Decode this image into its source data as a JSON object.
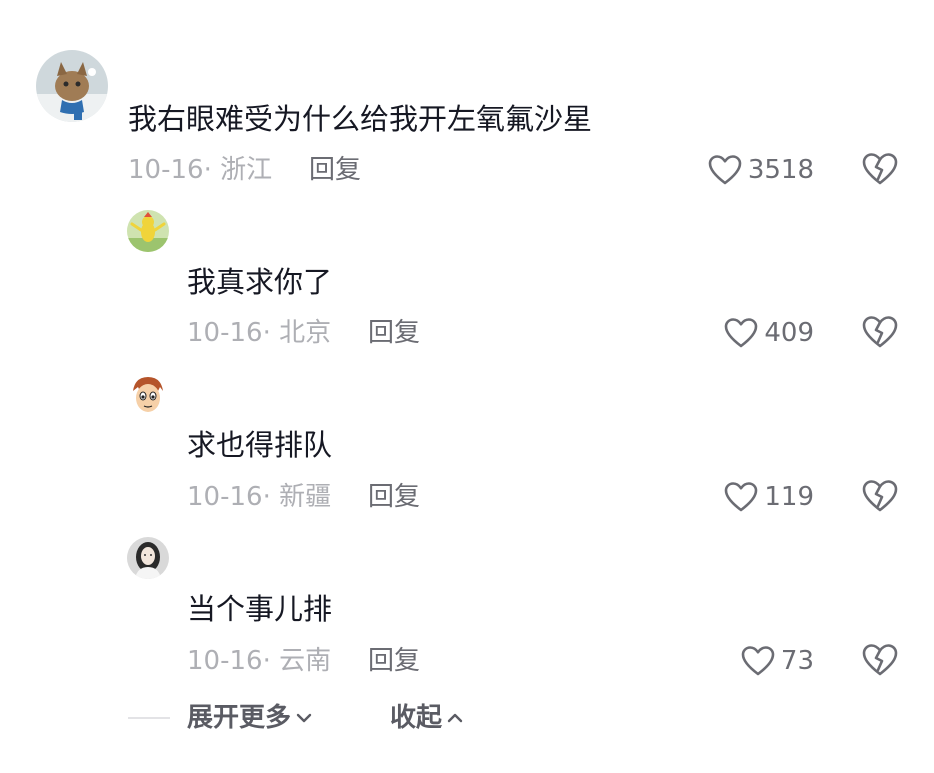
{
  "comments": [
    {
      "text": "我右眼难受为什么给我开左氧氟沙星",
      "date": "10-16",
      "location": "浙江",
      "reply_label": "回复",
      "likes": "3518",
      "avatar": "cat-with-scarf-avatar"
    },
    {
      "text": "我真求你了",
      "date": "10-16",
      "location": "北京",
      "reply_label": "回复",
      "likes": "409",
      "avatar": "yellow-cartoon-avatar"
    },
    {
      "text": "求也得排队",
      "date": "10-16",
      "location": "新疆",
      "reply_label": "回复",
      "likes": "119",
      "avatar": "cartoon-face-avatar"
    },
    {
      "text": "当个事儿排",
      "date": "10-16",
      "location": "云南",
      "reply_label": "回复",
      "likes": "73",
      "avatar": "portrait-photo-avatar"
    }
  ],
  "footer": {
    "expand_label": "展开更多",
    "collapse_label": "收起"
  },
  "colors": {
    "text": "#161823",
    "meta": "#aeafb4",
    "action": "#6b6c73"
  },
  "icons": {
    "like": "heart-outline-icon",
    "dislike": "broken-heart-icon",
    "expand": "chevron-down-icon",
    "collapse": "chevron-up-icon"
  }
}
